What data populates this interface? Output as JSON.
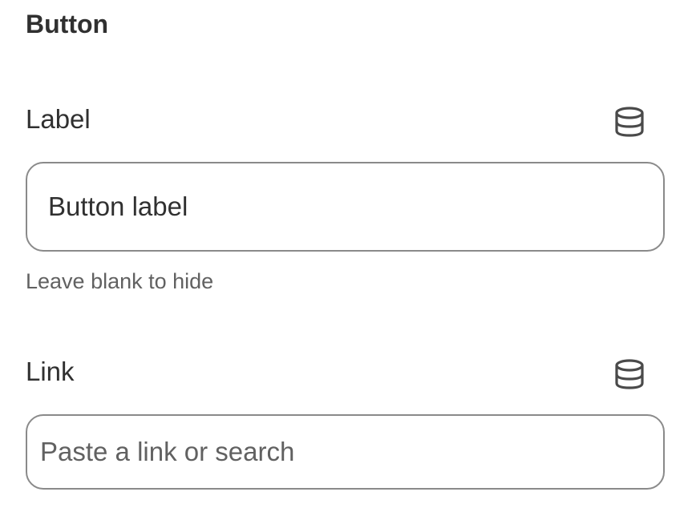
{
  "section": {
    "title": "Button"
  },
  "label_field": {
    "label": "Label",
    "value": "Button label",
    "placeholder": "",
    "help_text": "Leave blank to hide",
    "dynamic_source_icon": "database-icon"
  },
  "link_field": {
    "label": "Link",
    "value": "",
    "placeholder": "Paste a link or search",
    "dynamic_source_icon": "database-icon"
  },
  "colors": {
    "text": "#303030",
    "muted_text": "#616161",
    "border": "#8a8a8a"
  }
}
